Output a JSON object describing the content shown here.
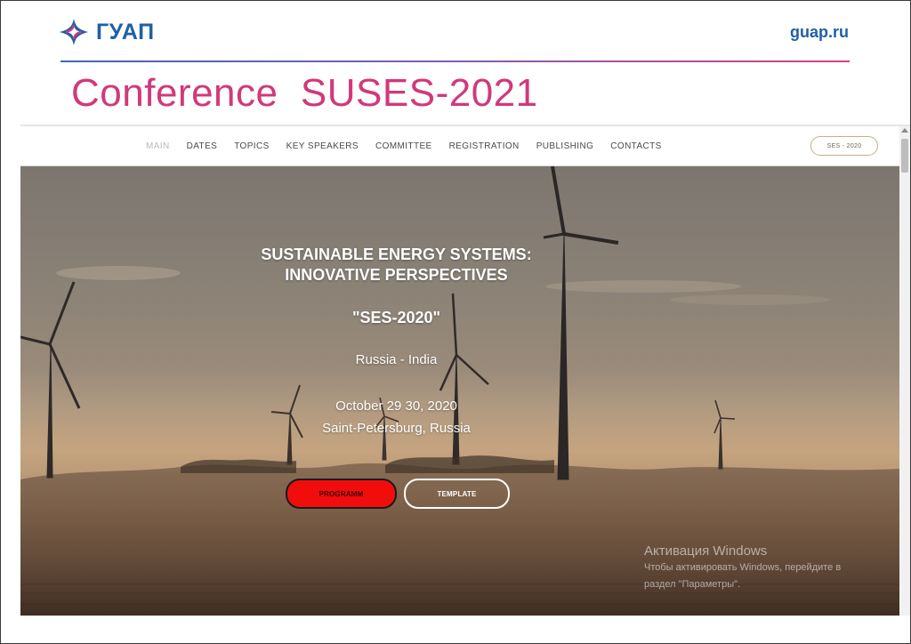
{
  "slide": {
    "logo_text": "ГУАП",
    "site_link": "guap.ru",
    "title": "Conference  SUSES-2021"
  },
  "nav": {
    "items": [
      {
        "label": "MAIN",
        "active": true
      },
      {
        "label": "DATES",
        "active": false
      },
      {
        "label": "TOPICS",
        "active": false
      },
      {
        "label": "KEY SPEAKERS",
        "active": false
      },
      {
        "label": "COMMITTEE",
        "active": false
      },
      {
        "label": "REGISTRATION",
        "active": false
      },
      {
        "label": "PUBLISHING",
        "active": false
      },
      {
        "label": "CONTACTS",
        "active": false
      }
    ],
    "badge": "SES - 2020"
  },
  "hero": {
    "title_line1": "SUSTAINABLE ENERGY SYSTEMS:",
    "title_line2": "INNOVATIVE PERSPECTIVES",
    "code": "\"SES-2020\"",
    "countries": "Russia - India",
    "date": "October 29 30, 2020",
    "place": "Saint-Petersburg, Russia",
    "program_button": "PROGRAMM",
    "template_button": "TEMPLATE"
  },
  "watermark": {
    "title": "Активация Windows",
    "line1": "Чтобы активировать Windows, перейдите в",
    "line2": "раздел \"Параметры\"."
  },
  "colors": {
    "brand_blue": "#1f5fa6",
    "title_pink": "#d1397a",
    "program_red": "#f20d0d"
  },
  "icons": {
    "logo": "guap-star-logo",
    "scroll": "scroll-up-arrow"
  }
}
